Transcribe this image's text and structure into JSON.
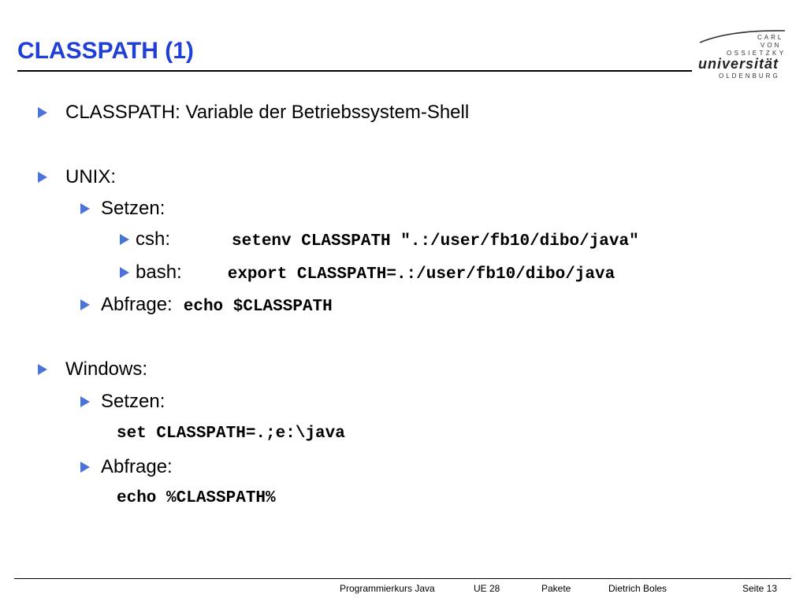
{
  "slide": {
    "title": "CLASSPATH (1)"
  },
  "logo": {
    "line1": "CARL",
    "line2": "VON",
    "line3": "OSSIETZKY",
    "line4": "universität",
    "line5": "OLDENBURG"
  },
  "content": {
    "item1": "CLASSPATH: Variable der Betriebssystem-Shell",
    "unix": {
      "label": "UNIX:",
      "setzen": "Setzen:",
      "csh_label": "csh:",
      "csh_cmd": "setenv CLASSPATH \".:/user/fb10/dibo/java\"",
      "bash_label": "bash:",
      "bash_cmd": "export CLASSPATH=.:/user/fb10/dibo/java",
      "abfrage_label": "Abfrage:",
      "abfrage_cmd": "echo $CLASSPATH"
    },
    "windows": {
      "label": "Windows:",
      "setzen": "Setzen:",
      "set_cmd": "set CLASSPATH=.;e:\\java",
      "abfrage_label": "Abfrage:",
      "abfrage_cmd": "echo %CLASSPATH%"
    }
  },
  "footer": {
    "course": "Programmierkurs Java",
    "unit": "UE 28",
    "topic": "Pakete",
    "author": "Dietrich Boles",
    "page": "Seite 13"
  },
  "colors": {
    "title": "#1f3fd6",
    "bullet": "#4a74d8"
  }
}
